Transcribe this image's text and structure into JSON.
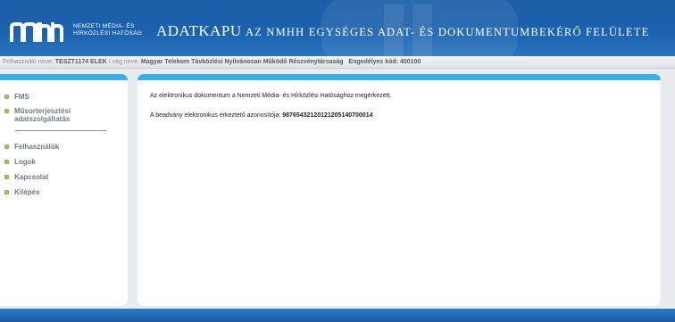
{
  "header": {
    "logo_text_line1": "NEMZETI MÉDIA- ÉS",
    "logo_text_line2": "HÍRKÖZLÉSI HATÓSÁG",
    "app_title": "ADATKAPU",
    "app_subtitle": "AZ NMHH EGYSÉGES ADAT- ÉS DOKUMENTUMBEKÉRŐ FELÜLETE"
  },
  "infobar": {
    "user_label": "Felhasználó neve: ",
    "user_value": "TESZT1174 ELEK",
    "company_label": " / cég neve: ",
    "company_value": "Magyar Telekom Távközlési Nyilvánosan Működő Részvénytársaság",
    "permit_label": "Engedélyes kód: 400100"
  },
  "sidebar": {
    "items": [
      {
        "label": "FMS"
      },
      {
        "label": "Műsorterjesztési adatszolgáltatás"
      },
      {
        "label": "Felhasználók"
      },
      {
        "label": "Logok"
      },
      {
        "label": "Kapcsolat"
      },
      {
        "label": "Kilépés"
      }
    ]
  },
  "main": {
    "message1": "Az elektronikus dokumentum a Nemzeti Média- és Hírközlési Hatósághoz megérkezett.",
    "message2_label": "A beadvány elektronikus érkeztető azonosítója: ",
    "message2_value": "98765432120121205140700014"
  },
  "colors": {
    "header_blue": "#1d5fa8",
    "accent_bar": "#3ab1e4",
    "bullet_green": "#8ec25a"
  }
}
